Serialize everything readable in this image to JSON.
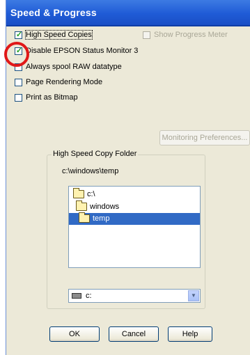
{
  "window": {
    "title": "Speed & Progress"
  },
  "options": {
    "high_speed_copies": {
      "label": "High Speed Copies",
      "checked": true
    },
    "show_progress_meter": {
      "label": "Show Progress Meter",
      "checked": false,
      "enabled": false
    },
    "disable_status_monitor": {
      "label": "Disable EPSON Status Monitor 3",
      "checked": true
    },
    "always_spool_raw": {
      "label": "Always spool RAW datatype",
      "checked": false
    },
    "page_rendering_mode": {
      "label": "Page Rendering Mode",
      "checked": false
    },
    "print_as_bitmap": {
      "label": "Print as Bitmap",
      "checked": false
    }
  },
  "monitoring_preferences_button": {
    "label": "Monitoring Preferences...",
    "enabled": false
  },
  "copy_folder": {
    "legend": "High Speed Copy Folder",
    "path": "c:\\windows\\temp",
    "tree": [
      {
        "label": "c:\\",
        "selected": false
      },
      {
        "label": "windows",
        "selected": false
      },
      {
        "label": "temp",
        "selected": true
      }
    ],
    "drive": {
      "icon": "drive-icon",
      "value": "c:"
    }
  },
  "buttons": {
    "ok": "OK",
    "cancel": "Cancel",
    "help": "Help"
  },
  "annotation": {
    "color": "#e01818"
  },
  "colors": {
    "titlebar": "#1f5bd6",
    "selection": "#316ac5",
    "checkmark": "#21a121",
    "dialog_bg": "#ece9d8"
  }
}
